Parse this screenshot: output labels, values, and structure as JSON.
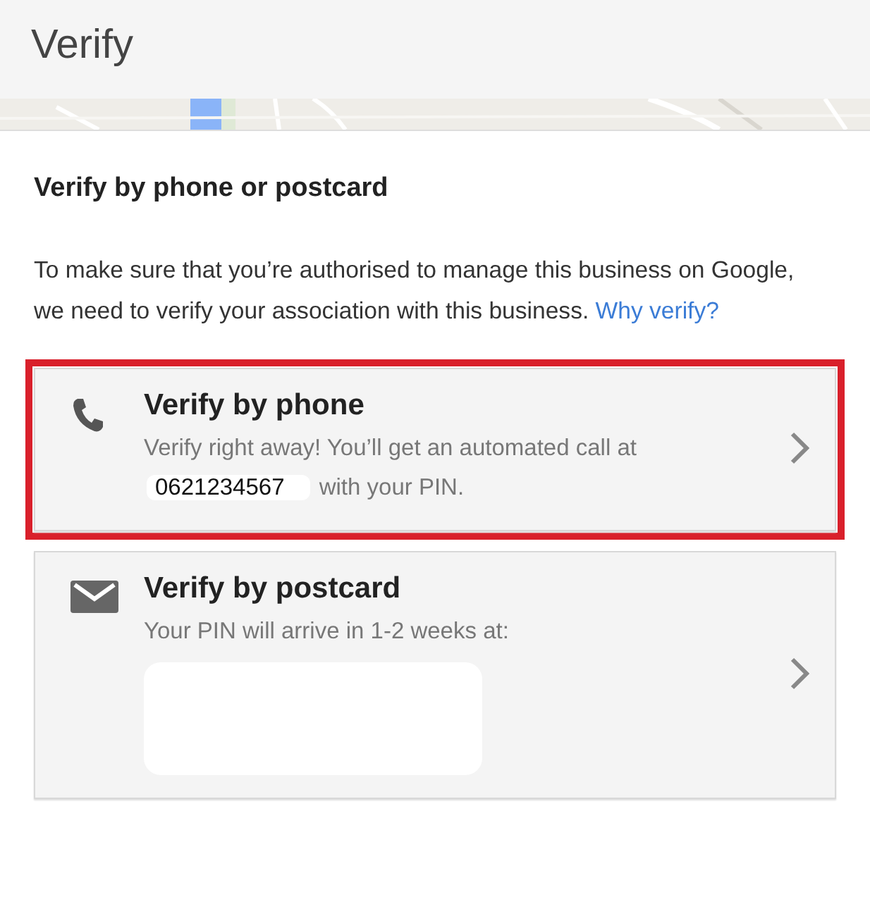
{
  "header": {
    "title": "Verify"
  },
  "heading": "Verify by phone or postcard",
  "intro": {
    "text": "To make sure that you’re authorised to manage this business on Google, we need to verify your association with this business.",
    "link": "Why verify?"
  },
  "options": [
    {
      "kind": "phone",
      "title": "Verify by phone",
      "description": "Verify right away! You’ll get an automated call at",
      "phone_number": "0621234567",
      "description_after": "with your PIN.",
      "highlighted": true
    },
    {
      "kind": "postcard",
      "title": "Verify by postcard",
      "description": "Your PIN will arrive in 1-2 weeks at:",
      "address_hidden": true,
      "highlighted": false
    }
  ]
}
